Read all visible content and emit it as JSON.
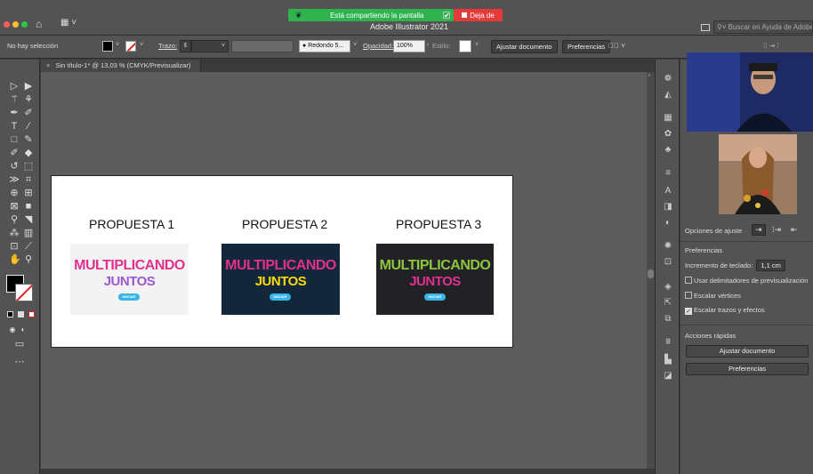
{
  "titlebar": {
    "app_title": "Adobe Illustrator 2021",
    "share_banner": "Está compartiendo la pantalla",
    "stop_share": "Deja de",
    "help_search_placeholder": "Buscar en Ayuda de Adobe"
  },
  "control_bar": {
    "selection_status": "No hay selección",
    "stroke_label": "Trazo:",
    "brush": "Redondo 5...",
    "opacity_label": "Opacidad:",
    "opacity_value": "100%",
    "style_label": "Estilo:",
    "fit_document": "Ajustar documento",
    "preferences": "Preferencias"
  },
  "document": {
    "tab_title": "Sin título-1* @ 13,03 % (CMYK/Previsualizar)"
  },
  "artboard": {
    "proposals": [
      {
        "label": "PROPUESTA 1",
        "logo_top": "MULTIPLICANDO",
        "logo_bottom": "JUNTOS",
        "button": "INICIAR"
      },
      {
        "label": "PROPUESTA 2",
        "logo_top": "MULTIPLICANDO",
        "logo_bottom": "JUNTOS",
        "button": "INICIAR"
      },
      {
        "label": "PROPUESTA 3",
        "logo_top": "MULTIPLICANDO",
        "logo_bottom": "JUNTOS",
        "button": "INICIAR"
      }
    ]
  },
  "properties_panel": {
    "snap_options": "Opciones de ajuste",
    "preferences_heading": "Preferencias",
    "keyboard_increment_label": "Incremento de teclado:",
    "keyboard_increment_value": "1,1 cm",
    "use_preview_bounds": "Usar delimitadores de previsualización",
    "use_preview_bounds_checked": false,
    "scale_corners": "Escalar vértices",
    "scale_corners_checked": false,
    "scale_strokes": "Escalar trazos y efectos",
    "scale_strokes_checked": true,
    "quick_actions": "Acciones rápidas",
    "fit_document_button": "Ajustar documento",
    "preferences_button": "Preferencias"
  },
  "colors": {
    "share_banner": "#2eb34f",
    "stop_share": "#e63a3a",
    "thumb_1_bg": "#f3f3f3",
    "thumb_2_bg": "#13273a",
    "thumb_3_bg": "#222226"
  }
}
